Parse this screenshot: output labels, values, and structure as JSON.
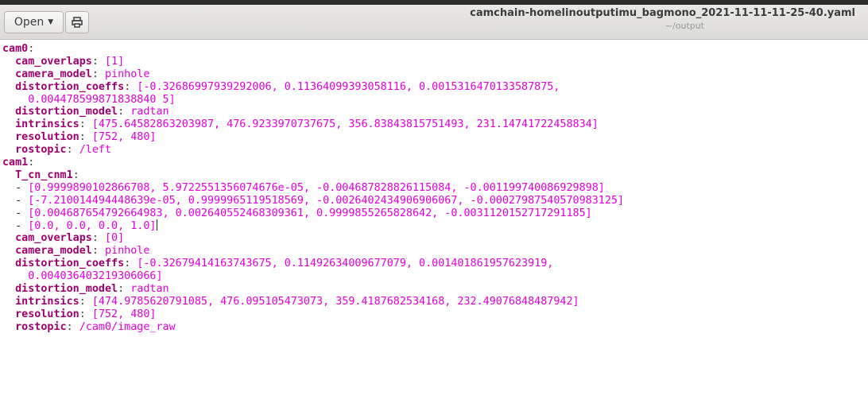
{
  "window": {
    "title": "camchain-homelinoutputimu_bagmono_2021-11-11-11-25-40.yaml",
    "subtitle": "~/output"
  },
  "toolbar": {
    "open_label": "Open",
    "print_icon": "printer-icon"
  },
  "colors": {
    "key": "#a0006e",
    "value": "#e300d9",
    "text": "#222222"
  },
  "lines": [
    {
      "indent": "",
      "key": "cam0",
      "dash": false,
      "value": "",
      "top": true
    },
    {
      "indent": "  ",
      "key": "cam_overlaps",
      "dash": false,
      "value": "[1]"
    },
    {
      "indent": "  ",
      "key": "camera_model",
      "dash": false,
      "value": "pinhole"
    },
    {
      "indent": "  ",
      "key": "distortion_coeffs",
      "dash": false,
      "value": "[-0.32686997939292006, 0.11364099393058116, 0.0015316470133587875,"
    },
    {
      "indent": "    ",
      "key": "",
      "dash": false,
      "value": "0.004478599871838840 5]"
    },
    {
      "indent": "  ",
      "key": "distortion_model",
      "dash": false,
      "value": "radtan"
    },
    {
      "indent": "  ",
      "key": "intrinsics",
      "dash": false,
      "value": "[475.64582863203987, 476.9233970737675, 356.83843815751493, 231.14741722458834]"
    },
    {
      "indent": "  ",
      "key": "resolution",
      "dash": false,
      "value": "[752, 480]"
    },
    {
      "indent": "  ",
      "key": "rostopic",
      "dash": false,
      "value": "/left"
    },
    {
      "indent": "",
      "key": "cam1",
      "dash": false,
      "value": "",
      "top": true
    },
    {
      "indent": "  ",
      "key": "T_cn_cnm1",
      "dash": false,
      "value": ""
    },
    {
      "indent": "  ",
      "key": "",
      "dash": true,
      "value": "[0.9999890102866708, 5.9722551356074676e-05, -0.004687828826115084, -0.001199740086929898]"
    },
    {
      "indent": "  ",
      "key": "",
      "dash": true,
      "value": "[-7.210014494448639e-05, 0.9999965119518569, -0.0026402434906906067, -0.00027987540570983125]"
    },
    {
      "indent": "  ",
      "key": "",
      "dash": true,
      "value": "[0.004687654792664983, 0.002640552468309361, 0.9999855265828642, -0.0031120152717291185]"
    },
    {
      "indent": "  ",
      "key": "",
      "dash": true,
      "value": "[0.0, 0.0, 0.0, 1.0]",
      "cursor": true
    },
    {
      "indent": "  ",
      "key": "cam_overlaps",
      "dash": false,
      "value": "[0]"
    },
    {
      "indent": "  ",
      "key": "camera_model",
      "dash": false,
      "value": "pinhole"
    },
    {
      "indent": "  ",
      "key": "distortion_coeffs",
      "dash": false,
      "value": "[-0.32679414163743675, 0.11492634009677079, 0.001401861957623919,"
    },
    {
      "indent": "    ",
      "key": "",
      "dash": false,
      "value": "0.004036403219306066]"
    },
    {
      "indent": "  ",
      "key": "distortion_model",
      "dash": false,
      "value": "radtan"
    },
    {
      "indent": "  ",
      "key": "intrinsics",
      "dash": false,
      "value": "[474.9785620791085, 476.095105473073, 359.4187682534168, 232.49076848487942]"
    },
    {
      "indent": "  ",
      "key": "resolution",
      "dash": false,
      "value": "[752, 480]"
    },
    {
      "indent": "  ",
      "key": "rostopic",
      "dash": false,
      "value": "/cam0/image_raw"
    }
  ]
}
